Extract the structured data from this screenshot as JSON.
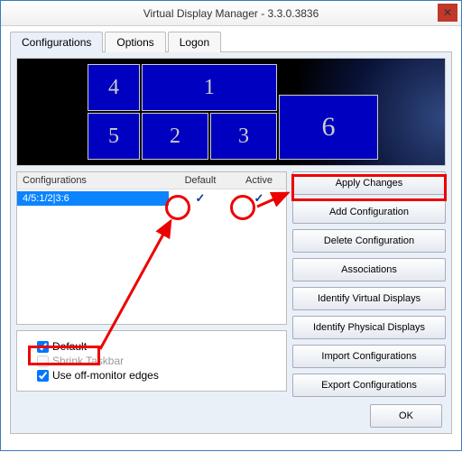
{
  "window": {
    "title": "Virtual Display Manager - 3.3.0.3836",
    "close": "✕"
  },
  "tabs": {
    "configurations": "Configurations",
    "options": "Options",
    "logon": "Logon"
  },
  "preview": {
    "r1": "1",
    "r2": "2",
    "r3": "3",
    "r4": "4",
    "r5": "5",
    "r6": "6"
  },
  "list": {
    "col_name": "Configurations",
    "col_default": "Default",
    "col_active": "Active",
    "row0_name": "4/5:1/2|3:6",
    "row0_default": "✓",
    "row0_active": "✓"
  },
  "opts": {
    "default": "Default",
    "shrink": "Shrink Taskbar",
    "offmon": "Use off-monitor edges"
  },
  "buttons": {
    "apply": "Apply Changes",
    "add": "Add Configuration",
    "delete": "Delete Configuration",
    "assoc": "Associations",
    "idv": "Identify Virtual Displays",
    "idp": "Identify Physical Displays",
    "import": "Import Configurations",
    "export": "Export Configurations",
    "ok": "OK"
  }
}
